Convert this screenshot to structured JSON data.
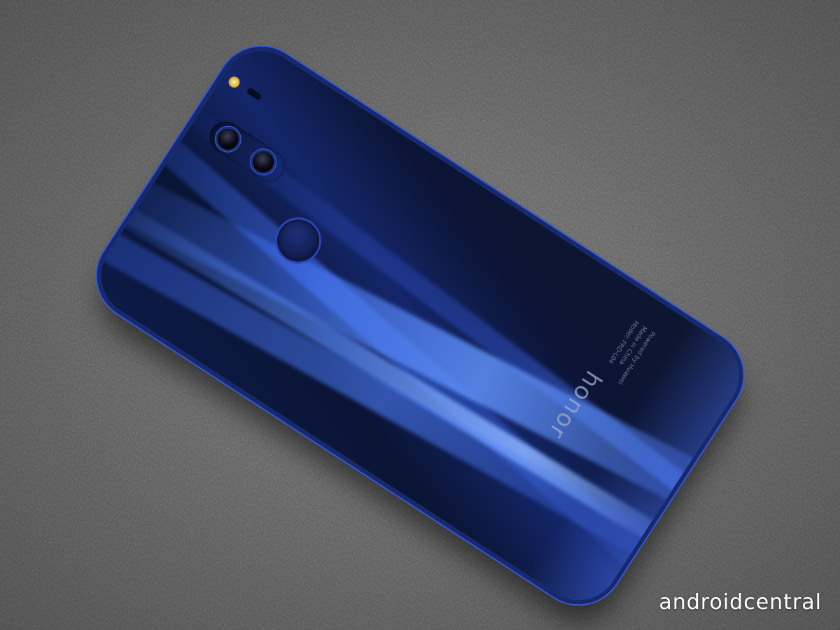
{
  "image": {
    "subject": "Honor smartphone back on fabric surface",
    "background_color": "#5f5f5f",
    "phone_color": "#14266a",
    "accent_color": "#4462d0"
  },
  "phone": {
    "brand": "honor",
    "fine_print": {
      "powered": "Powered by Huawei",
      "made_in": "Made in China",
      "model": "Model: FRD-L04"
    }
  },
  "watermark": {
    "text": "androidcentral"
  }
}
